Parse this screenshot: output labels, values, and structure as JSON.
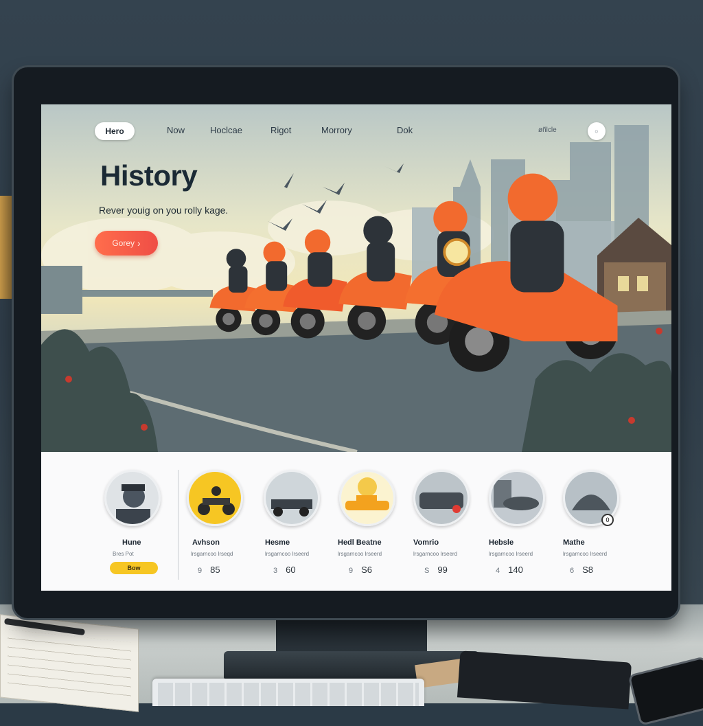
{
  "nav": {
    "logo": "Hero",
    "links": [
      "Now",
      "Hoclcae",
      "Rigot",
      "Morrory",
      "Dok"
    ],
    "right_text": "øñlcle",
    "right_icon": "circle-icon"
  },
  "hero": {
    "title": "History",
    "subtitle": "Rever youig on you rolly kage.",
    "cta_label": "Gorey",
    "cta_icon": "chevron-right-icon",
    "cta_color": "#f05a48"
  },
  "cards": [
    {
      "name": "Hune",
      "meta": "Bres Pot",
      "stat_icon": "",
      "stat": "",
      "button": "Bow"
    },
    {
      "name": "Avhson",
      "meta": "lrsgarncoo lrseqd",
      "stat_icon": "9",
      "stat": "85"
    },
    {
      "name": "Hesme",
      "meta": "lrsgarncoo lrseerd",
      "stat_icon": "3",
      "stat": "60"
    },
    {
      "name": "Hedl Beatne",
      "meta": "lrsgarncoo lrseerd",
      "stat_icon": "9",
      "stat": "S6"
    },
    {
      "name": "Vomrio",
      "meta": "lrsgarncoo lrseerd",
      "stat_icon": "S",
      "stat": "99"
    },
    {
      "name": "Hebsle",
      "meta": "lrsgarncoo lrseerd",
      "stat_icon": "4",
      "stat": "140"
    },
    {
      "name": "Mathe",
      "meta": "lrsgarncoo lrseerd",
      "stat_icon": "6",
      "stat": "S8"
    }
  ],
  "colors": {
    "accent_yellow": "#f6c623",
    "scooter_orange": "#f2662d",
    "text_dark": "#1b2a35"
  }
}
